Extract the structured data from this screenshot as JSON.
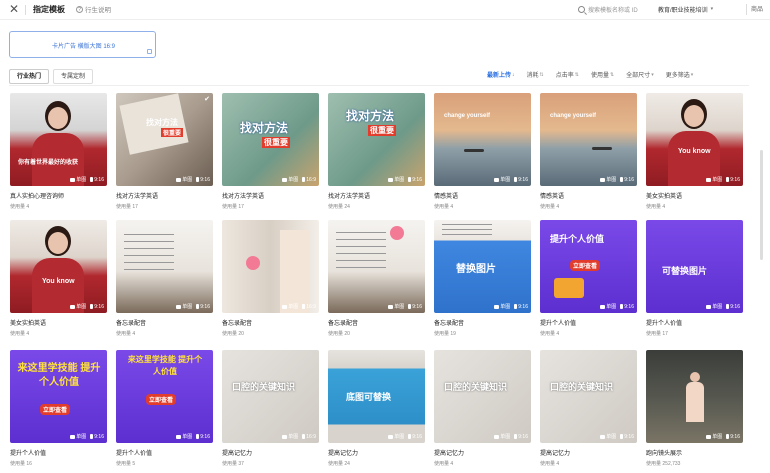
{
  "header": {
    "close_icon": "close-icon",
    "title": "指定模板",
    "help_text": "行生说明",
    "search_placeholder": "搜索模板名称或 ID",
    "category": "教育/职业技能培训",
    "product": "商品"
  },
  "ad": {
    "label": "卡片广告 横版大图 16:9"
  },
  "tabs": [
    {
      "label": "行业热门",
      "active": true
    },
    {
      "label": "专属定制",
      "active": false
    }
  ],
  "filters": [
    {
      "label": "最新上传",
      "active": true
    },
    {
      "label": "消耗",
      "active": false
    },
    {
      "label": "点击率",
      "active": false
    },
    {
      "label": "使用量",
      "active": false
    },
    {
      "label": "全部尺寸",
      "active": false
    },
    {
      "label": "更多筛选",
      "active": false
    }
  ],
  "badge": {
    "img": "单图",
    "ratio": "9:16",
    "ratio_wide": "16:9"
  },
  "cards": [
    {
      "title": "真人实拍心理咨询师",
      "usage": "使用量 4",
      "overlay": "你有着世界最好的收获",
      "ratio": "9:16"
    },
    {
      "title": "找对方法学英语",
      "usage": "使用量 17",
      "overlay": "找对方法 很重要",
      "ratio": "9:16"
    },
    {
      "title": "找对方法学英语",
      "usage": "使用量 17",
      "overlay": "找对方法 很重要",
      "ratio": "16:9"
    },
    {
      "title": "找对方法学英语",
      "usage": "使用量 24",
      "overlay": "找对方法 很重要",
      "ratio": "9:16"
    },
    {
      "title": "情感英语",
      "usage": "使用量 4",
      "overlay": "change yourself",
      "ratio": "9:16"
    },
    {
      "title": "情感英语",
      "usage": "使用量 4",
      "overlay": "change yourself",
      "ratio": "9:16"
    },
    {
      "title": "美女实拍英语",
      "usage": "使用量 4",
      "overlay": "You know",
      "ratio": "9:16"
    },
    {
      "title": "美女实拍英语",
      "usage": "使用量 4",
      "overlay": "You know",
      "ratio": "9:16"
    },
    {
      "title": "备忘录配音",
      "usage": "使用量 4",
      "overlay": "",
      "ratio": "9:16"
    },
    {
      "title": "备忘录配音",
      "usage": "使用量 20",
      "overlay": "",
      "ratio": "16:9"
    },
    {
      "title": "备忘录配音",
      "usage": "使用量 20",
      "overlay": "",
      "ratio": "9:16"
    },
    {
      "title": "备忘录配音",
      "usage": "使用量 19",
      "overlay": "替换图片",
      "ratio": "9:16"
    },
    {
      "title": "提升个人价值",
      "usage": "使用量 4",
      "overlay": "提升个人价值",
      "ratio": "9:16"
    },
    {
      "title": "提升个人价值",
      "usage": "使用量 17",
      "overlay": "可替换图片",
      "ratio": "9:16"
    },
    {
      "title": "提升个人价值",
      "usage": "使用量 16",
      "overlay": "来这里学技能 提升个人价值",
      "ratio": "9:16"
    },
    {
      "title": "提升个人价值",
      "usage": "使用量 5",
      "overlay": "来这里学技能 提升个人价值",
      "ratio": "9:16"
    },
    {
      "title": "提高记忆力",
      "usage": "使用量 37",
      "overlay": "",
      "ratio": "16:9"
    },
    {
      "title": "提高记忆力",
      "usage": "使用量 24",
      "overlay": "底图可替换",
      "ratio": "9:16"
    },
    {
      "title": "提高记忆力",
      "usage": "使用量 4",
      "overlay": "",
      "ratio": "9:16"
    },
    {
      "title": "提高记忆力",
      "usage": "使用量 4",
      "overlay": "",
      "ratio": "9:16"
    },
    {
      "title": "跑向镜头展示",
      "usage": "使用量 252,733",
      "overlay": "",
      "ratio": "9:16"
    }
  ],
  "colors": {
    "accent": "#2a6fe0",
    "purple": "#6f3fe0",
    "yellow": "#ffe23a"
  }
}
